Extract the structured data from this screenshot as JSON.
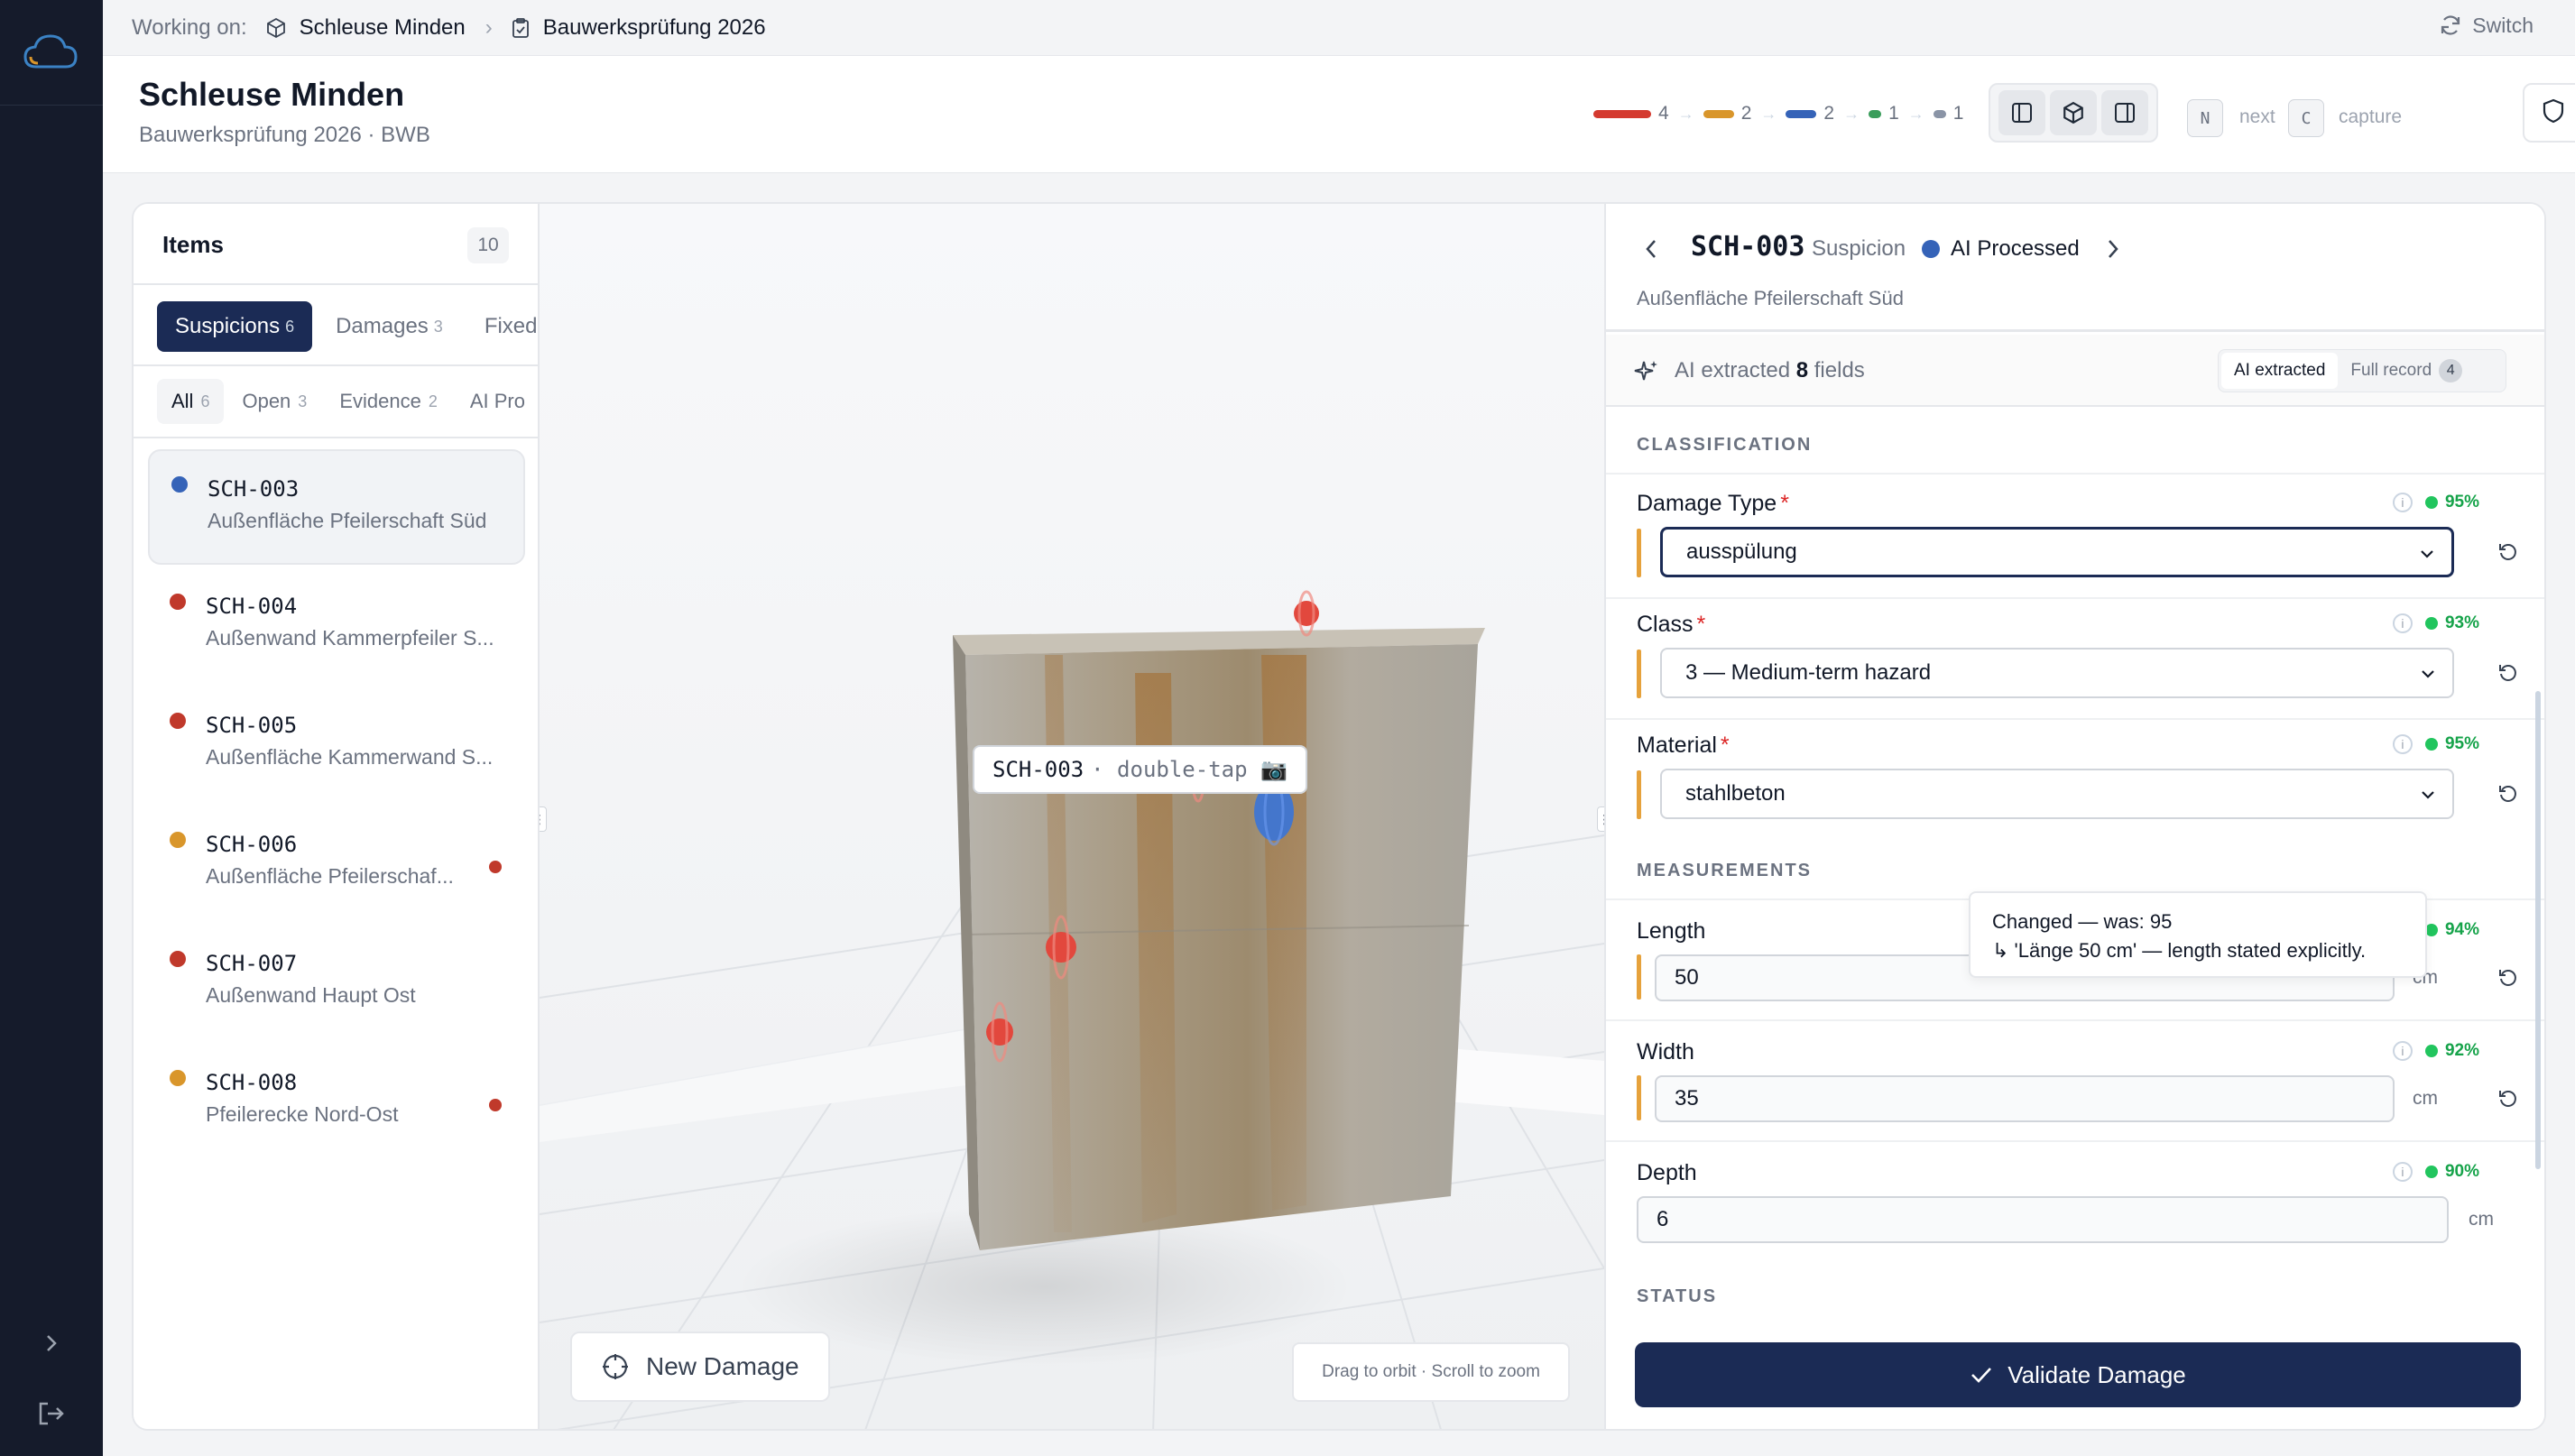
{
  "topbar": {
    "working_on": "Working on:",
    "project": "Schleuse Minden",
    "inspection": "Bauwerksprüfung 2026",
    "switch": "Switch"
  },
  "header": {
    "title": "Schleuse Minden",
    "subtitle": "Bauwerksprüfung 2026 · BWB",
    "pipeline": [
      {
        "count": "4",
        "color": "#d43a2f",
        "width": 64
      },
      {
        "count": "2",
        "color": "#d9962b",
        "width": 34
      },
      {
        "count": "2",
        "color": "#3563b8",
        "width": 34
      },
      {
        "count": "1",
        "color": "#3a9d5b",
        "width": 14
      },
      {
        "count": "1",
        "color": "#8a94a6",
        "width": 14
      }
    ],
    "kbd_next": "N",
    "kbd_next_label": "next",
    "kbd_capture": "C",
    "kbd_capture_label": "capture"
  },
  "items": {
    "heading": "Items",
    "count": "10",
    "tabs": [
      {
        "label": "Suspicions",
        "n": "6"
      },
      {
        "label": "Damages",
        "n": "3"
      },
      {
        "label": "Fixed",
        "n": ""
      }
    ],
    "filters": [
      {
        "label": "All",
        "n": "6"
      },
      {
        "label": "Open",
        "n": "3"
      },
      {
        "label": "Evidence",
        "n": "2"
      },
      {
        "label": "AI Pro",
        "n": ""
      }
    ],
    "list": [
      {
        "code": "SCH-003",
        "loc": "Außenfläche Pfeilerschaft Süd",
        "color": "#3563b8",
        "flag": false
      },
      {
        "code": "SCH-004",
        "loc": "Außenwand Kammerpfeiler S...",
        "color": "#c0392b",
        "flag": false
      },
      {
        "code": "SCH-005",
        "loc": "Außenfläche Kammerwand S...",
        "color": "#c0392b",
        "flag": false
      },
      {
        "code": "SCH-006",
        "loc": "Außenfläche Pfeilerschaf...",
        "color": "#d9962b",
        "flag": true
      },
      {
        "code": "SCH-007",
        "loc": "Außenwand Haupt Ost",
        "color": "#c0392b",
        "flag": false
      },
      {
        "code": "SCH-008",
        "loc": "Pfeilerecke Nord-Ost",
        "color": "#d9962b",
        "flag": true
      }
    ]
  },
  "viewer": {
    "marker_code": "SCH-003",
    "marker_hint": "· double-tap 📷",
    "new_damage": "New Damage",
    "orbit_hint": "Drag to orbit · Scroll to zoom"
  },
  "detail": {
    "code": "SCH-003",
    "kind": "Suspicion",
    "status": "AI Processed",
    "location": "Außenfläche Pfeilerschaft Süd",
    "ai_prefix": "AI extracted",
    "ai_count": "8",
    "ai_suffix": "fields",
    "seg_ai": "AI extracted",
    "seg_full": "Full record",
    "seg_full_count": "4",
    "section_classification": "CLASSIFICATION",
    "section_measurements": "MEASUREMENTS",
    "section_status": "STATUS",
    "fields": {
      "damage_type": {
        "label": "Damage Type",
        "value": "ausspülung",
        "conf": "95%"
      },
      "class": {
        "label": "Class",
        "value": "3 — Medium-term hazard",
        "conf": "93%"
      },
      "material": {
        "label": "Material",
        "value": "stahlbeton",
        "conf": "95%"
      },
      "length": {
        "label": "Length",
        "value": "50",
        "unit": "cm",
        "conf": "94%"
      },
      "width": {
        "label": "Width",
        "value": "35",
        "unit": "cm",
        "conf": "92%"
      },
      "depth": {
        "label": "Depth",
        "value": "6",
        "unit": "cm",
        "conf": "90%"
      }
    },
    "change_tip_line1": "Changed — was: 95",
    "change_tip_line2": "↳ 'Länge 50 cm' — length stated explicitly.",
    "validate": "Validate Damage"
  }
}
